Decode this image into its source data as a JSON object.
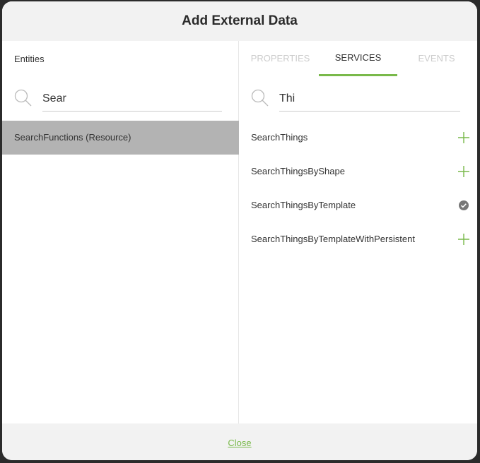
{
  "dialog": {
    "title": "Add External Data",
    "close_label": "Close"
  },
  "entities": {
    "title": "Entities",
    "search_value": "Sear",
    "items": [
      {
        "label": "SearchFunctions (Resource)",
        "selected": true
      }
    ]
  },
  "tabs": [
    {
      "label": "PROPERTIES",
      "active": false
    },
    {
      "label": "SERVICES",
      "active": true
    },
    {
      "label": "EVENTS",
      "active": false
    }
  ],
  "services": {
    "search_value": "Thi",
    "items": [
      {
        "label": "SearchThings",
        "state": "add-icon"
      },
      {
        "label": "SearchThingsByShape",
        "state": "add-icon"
      },
      {
        "label": "SearchThingsByTemplate",
        "state": "check-circle-icon"
      },
      {
        "label": "SearchThingsByTemplateWithPersistent",
        "state": "add-icon"
      }
    ]
  },
  "colors": {
    "accent": "#79b94a",
    "selected_row": "#b3b3b3",
    "header_bg": "#f2f2f2"
  }
}
